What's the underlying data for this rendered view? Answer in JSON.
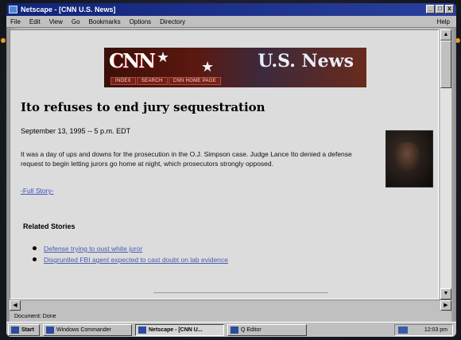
{
  "window": {
    "title": "Netscape - [CNN U.S. News]",
    "controls": [
      "_",
      "□",
      "x"
    ]
  },
  "menu": {
    "items": [
      "File",
      "Edit",
      "View",
      "Go",
      "Bookmarks",
      "Options",
      "Directory"
    ],
    "help": "Help"
  },
  "banner": {
    "logo": "CNN",
    "title": "U.S. News",
    "nav": [
      "INDEX",
      "SEARCH",
      "CNN HOME PAGE"
    ]
  },
  "article": {
    "headline": "Ito refuses to end jury sequestration",
    "dateline": "September 13, 1995 -- 5 p.m. EDT",
    "body": "It was a day of ups and downs for the prosecution in the O.J. Simpson case. Judge Lance Ito denied a defense request to begin letting jurors go home at night, which prosecutors strongly opposed.",
    "full_story": "-Full Story-"
  },
  "related": {
    "title": "Related Stories",
    "items": [
      "Defense trying to oust white juror",
      "Disgruntled FBI agent expected to cast doubt on lab evidence"
    ]
  },
  "status": {
    "text": "Document: Done"
  },
  "taskbar": {
    "start": "Start",
    "tasks": [
      "Windows Commander",
      "Netscape - [CNN U...",
      "Q Editor"
    ],
    "clock": "12:03 pm"
  }
}
